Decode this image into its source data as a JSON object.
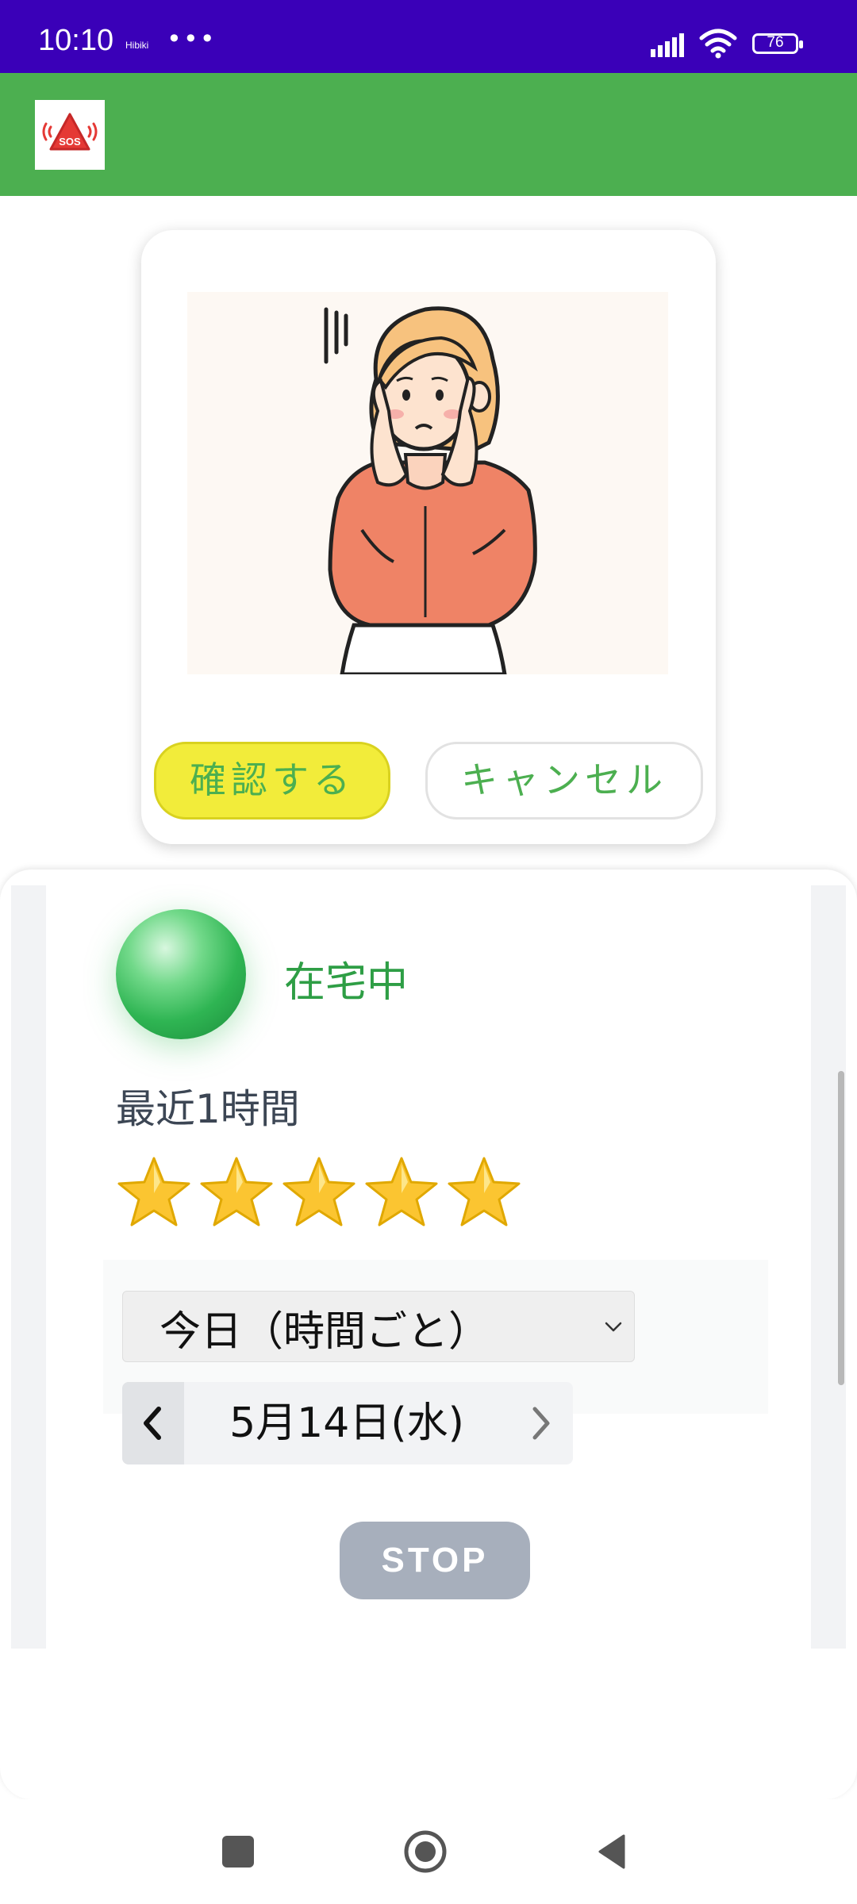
{
  "status_bar": {
    "time": "10:10",
    "carrier": "Hibiki",
    "more": "•••",
    "battery": "76",
    "background": "#3a00b8"
  },
  "app_bar": {
    "logo_text": "SOS",
    "background": "#4caf50"
  },
  "confirm_card": {
    "confirm_label": "確認する",
    "cancel_label": "キャンセル",
    "confirm_color": "#f2ec3a",
    "text_color": "#4caf50"
  },
  "status": {
    "label": "在宅中",
    "indicator_color": "#2fb553"
  },
  "recent": {
    "label": "最近1時間",
    "stars": 5,
    "max_stars": 5
  },
  "period": {
    "selected": "今日（時間ごと）"
  },
  "date_nav": {
    "date": "5月14日(水)"
  },
  "stop_button": {
    "label": "STOP",
    "color": "#a7afbc"
  }
}
